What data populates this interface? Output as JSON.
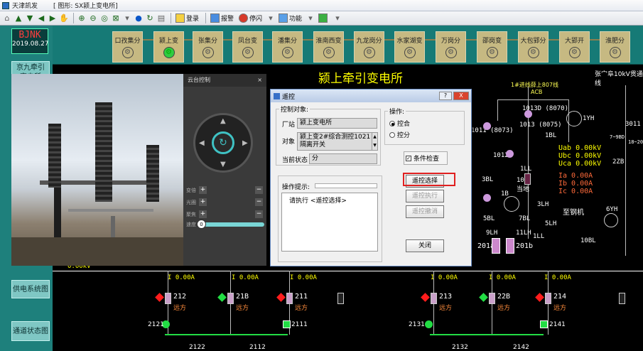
{
  "window": {
    "app_name": "天津凯发",
    "title": "[ 图形: SX颍上变电所]"
  },
  "toolbar": {
    "login": "登录",
    "alarm": "报警",
    "flash": "停闪",
    "function": "功能"
  },
  "left_panel": {
    "clock_line1": "BJNK",
    "clock_line2": "2019.08.27",
    "btn_top": "京九牵引\n变电所",
    "btn_power": "供电系统图",
    "btn_channel": "通道状态图"
  },
  "substations": [
    {
      "label": "口孜集分"
    },
    {
      "label": "颍上变"
    },
    {
      "label": "张集分"
    },
    {
      "label": "凤台变"
    },
    {
      "label": "潘集分"
    },
    {
      "label": "淮南西变"
    },
    {
      "label": "九龙岗分"
    },
    {
      "label": "水家湖变"
    },
    {
      "label": "万岗分"
    },
    {
      "label": "邵岗变"
    },
    {
      "label": "大包郢分"
    },
    {
      "label": "大郢开"
    },
    {
      "label": "淮肥分"
    }
  ],
  "diagram": {
    "title": "颍上牵引变电所",
    "bus1": "1#进线薛上807线",
    "bus1_sub": "ACB",
    "bus2": "张宀阜10kV贯通线",
    "labels": {
      "s1013d": "1013D (8070)",
      "s1013": "1013 (8075)",
      "s1011": "1011 (8073)",
      "s1012": "1012",
      "s1ll": "1LL",
      "s101": "101",
      "local": "当地",
      "s1yh": "1YH",
      "s1bl": "1BL",
      "s3bl": "3BL",
      "s1b": "1B",
      "s3lh": "3LH",
      "s5bl": "5BL",
      "s7bl": "7BL",
      "s9lh": "9LH",
      "s11lh": "11LH",
      "s1ll2": "1LL",
      "s5lh": "5LH",
      "zgangji": "至钢机",
      "s201a": "201a",
      "s201b": "201b",
      "s6yh": "6YH",
      "s10bl": "10BL",
      "s3011": "3011",
      "s7bd": "7~9BD",
      "s18_20": "18~20",
      "s2zb": "2ZB"
    },
    "measurements": {
      "uab": "Uab 0.00kV",
      "ubc": "Ubc 0.00kV",
      "uca": "Uca 0.00kV",
      "ia": "Ia 0.00A",
      "ib": "Ib 0.00A",
      "ic": "Ic 0.00A"
    },
    "voltage_left": "0.00kV",
    "currents": [
      "I 0.00A",
      "I 0.00A",
      "I 0.00A",
      "I 0.00A",
      "I 0.00A",
      "I 0.00A"
    ],
    "feeders": [
      {
        "id": "212",
        "mode": "远方"
      },
      {
        "id": "21B",
        "mode": "远方"
      },
      {
        "id": "211",
        "mode": "远方"
      },
      {
        "id": "213",
        "mode": "远方"
      },
      {
        "id": "22B",
        "mode": "远方"
      },
      {
        "id": "214",
        "mode": "远方"
      }
    ],
    "switches": {
      "s2121": "2121",
      "s2111": "2111",
      "s2131": "2131",
      "s2141": "2141",
      "s2122": "2122",
      "s2112": "2112",
      "s2132": "2132",
      "s2142": "2142"
    }
  },
  "camera_control": {
    "title": "云台控制",
    "close": "×",
    "zoom": "变倍",
    "focus": "光圈",
    "aperture": "聚焦",
    "speed": "速度",
    "speed_value": "0"
  },
  "dialog": {
    "title": "遥控",
    "help": "?",
    "close": "X",
    "control_object_legend": "控制对象:",
    "station_label": "厂站",
    "station_value": "颍上变电所",
    "object_label": "对象",
    "object_value": "颍上变2#综合测控1021隔离开关",
    "state_label": "当前状态",
    "state_value": "分",
    "operation_legend": "操作:",
    "op_close": "控合",
    "op_open": "控分",
    "condition_check": "条件检查",
    "hint_legend": "操作提示:",
    "hint_text": "请执行 <遥控选择>",
    "btn_select": "遥控选择",
    "btn_execute": "遥控执行",
    "btn_cancel": "遥控撤消",
    "btn_close": "关闭"
  }
}
